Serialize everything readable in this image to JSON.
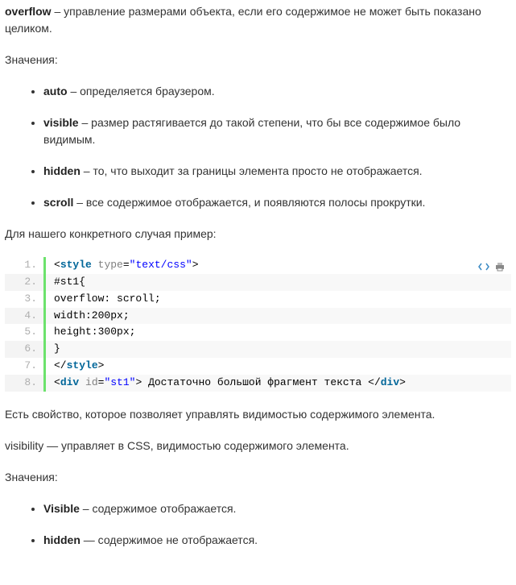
{
  "intro": {
    "term": "overflow",
    "desc": " – управление размерами объекта, если его содержимое не может быть показано целиком."
  },
  "values1_heading": "Значения:",
  "values1": [
    {
      "term": "auto",
      "desc": " – определяется браузером."
    },
    {
      "term": "visible",
      "desc": " – размер растягивается до такой степени, что бы все содержимое было видимым."
    },
    {
      "term": "hidden",
      "desc": " – то, что выходит за границы элемента просто не отображается."
    },
    {
      "term": "scroll",
      "desc": " – все содержимое отображается, и появляются полосы прокрутки."
    }
  ],
  "example_label": "Для нашего конкретного случая пример:",
  "code": {
    "lines": [
      {
        "n": "1.",
        "tokens": [
          {
            "cls": "tok-angle",
            "t": "<"
          },
          {
            "cls": "tok-tag",
            "t": "style"
          },
          {
            "cls": "tok-plain",
            "t": " "
          },
          {
            "cls": "tok-attr",
            "t": "type"
          },
          {
            "cls": "tok-plain",
            "t": "="
          },
          {
            "cls": "tok-str",
            "t": "\"text/css\""
          },
          {
            "cls": "tok-angle",
            "t": ">"
          }
        ]
      },
      {
        "n": "2.",
        "tokens": [
          {
            "cls": "tok-plain",
            "t": "#st1{"
          }
        ]
      },
      {
        "n": "3.",
        "tokens": [
          {
            "cls": "tok-plain",
            "t": "overflow: scroll;"
          }
        ]
      },
      {
        "n": "4.",
        "tokens": [
          {
            "cls": "tok-plain",
            "t": "width:200px;"
          }
        ]
      },
      {
        "n": "5.",
        "tokens": [
          {
            "cls": "tok-plain",
            "t": "height:300px;"
          }
        ]
      },
      {
        "n": "6.",
        "tokens": [
          {
            "cls": "tok-plain",
            "t": "}"
          }
        ]
      },
      {
        "n": "7.",
        "tokens": [
          {
            "cls": "tok-angle",
            "t": "</"
          },
          {
            "cls": "tok-tag",
            "t": "style"
          },
          {
            "cls": "tok-angle",
            "t": ">"
          }
        ]
      },
      {
        "n": "8.",
        "tokens": [
          {
            "cls": "tok-angle",
            "t": "<"
          },
          {
            "cls": "tok-tag",
            "t": "div"
          },
          {
            "cls": "tok-plain",
            "t": " "
          },
          {
            "cls": "tok-attr",
            "t": "id"
          },
          {
            "cls": "tok-plain",
            "t": "="
          },
          {
            "cls": "tok-str",
            "t": "\"st1\""
          },
          {
            "cls": "tok-angle",
            "t": ">"
          },
          {
            "cls": "tok-plain",
            "t": " Достаточно большой фрагмент текста "
          },
          {
            "cls": "tok-angle",
            "t": "</"
          },
          {
            "cls": "tok-tag",
            "t": "div"
          },
          {
            "cls": "tok-angle",
            "t": ">"
          }
        ]
      }
    ]
  },
  "para2": "Есть свойство, которое позволяет управлять видимостью содержимого элемента.",
  "para3": "visibility — управляет в CSS, видимостью содержимого элемента.",
  "values2_heading": "Значения:",
  "values2": [
    {
      "term": "Visible",
      "desc": " – содержимое отображается."
    },
    {
      "term": "hidden",
      "desc": " — содержимое не отображается."
    }
  ]
}
